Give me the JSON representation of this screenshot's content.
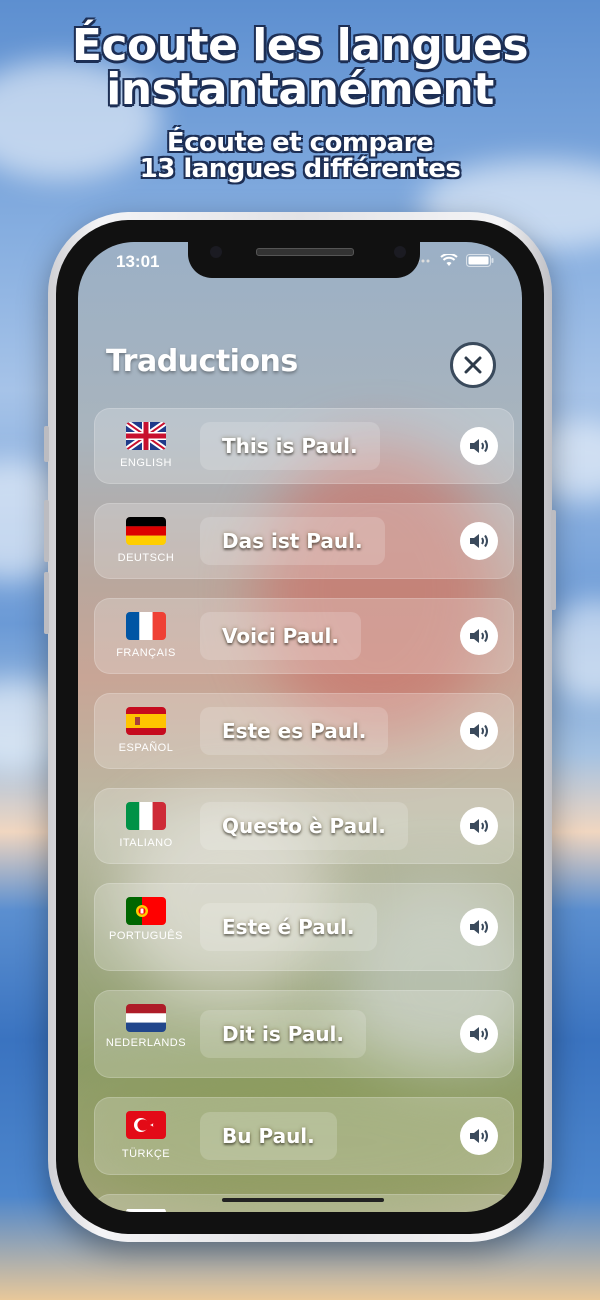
{
  "header": {
    "title_line1": "Écoute les langues",
    "title_line2": "instantanément",
    "subtitle_line1": "Écoute et compare",
    "subtitle_line2": "13 langues différentes"
  },
  "status_bar": {
    "time": "13:01"
  },
  "screen_title": "Traductions",
  "translations": [
    {
      "language": "ENGLISH",
      "text": "This is Paul."
    },
    {
      "language": "DEUTSCH",
      "text": "Das ist Paul."
    },
    {
      "language": "FRANÇAIS",
      "text": "Voici Paul."
    },
    {
      "language": "ESPAÑOL",
      "text": "Este es Paul."
    },
    {
      "language": "ITALIANO",
      "text": "Questo è Paul."
    },
    {
      "language": "PORTUGUÊS",
      "text": "Este é Paul."
    },
    {
      "language": "NEDERLANDS",
      "text": "Dit is Paul."
    },
    {
      "language": "TÜRKÇE",
      "text": "Bu Paul."
    }
  ]
}
